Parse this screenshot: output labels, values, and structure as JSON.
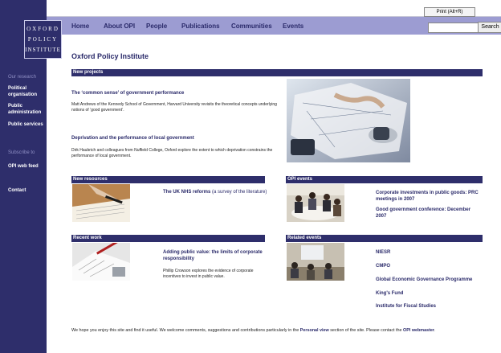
{
  "top": {
    "print_label": "Print (Alt+R)"
  },
  "nav": {
    "items": [
      "Home",
      "About OPI",
      "People",
      "Publications",
      "Communities",
      "Events"
    ],
    "search_button": "Search",
    "search_placeholder": ""
  },
  "logo": {
    "lines": [
      "OXFORD",
      "POLICY",
      "INSTITUTE"
    ]
  },
  "sidebar": {
    "our_research": "Our research",
    "research_items": [
      "Political organisation",
      "Public administration",
      "Public services"
    ],
    "subscribe": "Subscribe to",
    "feed": "OPI web feed",
    "contact": "Contact"
  },
  "main": {
    "title": "Oxford Policy Institute",
    "new_projects": {
      "header": "New projects",
      "item1_title": "The ‘common sense’ of government performance",
      "item1_text": "Matt Andrews of the Kennedy School of Government, Harvard University revisits the theoretical concepts underlying notions of ‘good government’.",
      "item2_title": "Deprivation and the performance of local government",
      "item2_text": "Dirk Haubrich and colleagues from Nuffield College, Oxford explore the extent to which deprivation constrains the performance of local government."
    },
    "new_resources": {
      "header": "New resources",
      "link": "The UK NHS reforms",
      "link_suffix": " (a survey of the literature)"
    },
    "opi_events": {
      "header": "OPI events",
      "item1": "Corporate investments in public goods: PRC meetings in 2007",
      "item2": "Good government conference: December 2007"
    },
    "recent_work": {
      "header": "Recent work",
      "title": "Adding public value: the limits of corporate responsibility",
      "text": "Phillip Crowson explores the evidence of corporate incentives to invest in public value."
    },
    "related_events": {
      "header": "Related events",
      "items": [
        "NIESR",
        "CMPO",
        "Global Economic Governance Programme",
        "King's Fund",
        "Institute for Fiscal Studies"
      ]
    },
    "footer": {
      "text_a": "We hope you enjoy this site and find it useful. We welcome comments, suggestions and contributions particularly in the ",
      "link1": "Personal view",
      "text_b": " section of the site. Please contact the ",
      "link2": "OPI webmaster",
      "text_c": "."
    }
  }
}
